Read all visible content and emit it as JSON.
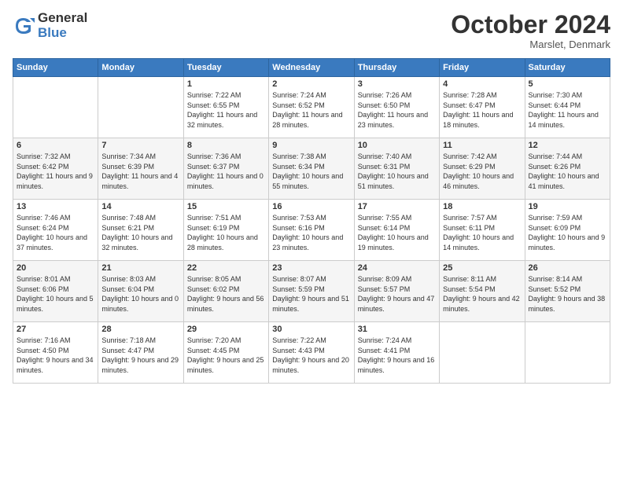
{
  "logo": {
    "general": "General",
    "blue": "Blue"
  },
  "header": {
    "month": "October 2024",
    "location": "Marslet, Denmark"
  },
  "weekdays": [
    "Sunday",
    "Monday",
    "Tuesday",
    "Wednesday",
    "Thursday",
    "Friday",
    "Saturday"
  ],
  "weeks": [
    [
      {
        "day": null
      },
      {
        "day": null
      },
      {
        "day": "1",
        "sunrise": "Sunrise: 7:22 AM",
        "sunset": "Sunset: 6:55 PM",
        "daylight": "Daylight: 11 hours and 32 minutes."
      },
      {
        "day": "2",
        "sunrise": "Sunrise: 7:24 AM",
        "sunset": "Sunset: 6:52 PM",
        "daylight": "Daylight: 11 hours and 28 minutes."
      },
      {
        "day": "3",
        "sunrise": "Sunrise: 7:26 AM",
        "sunset": "Sunset: 6:50 PM",
        "daylight": "Daylight: 11 hours and 23 minutes."
      },
      {
        "day": "4",
        "sunrise": "Sunrise: 7:28 AM",
        "sunset": "Sunset: 6:47 PM",
        "daylight": "Daylight: 11 hours and 18 minutes."
      },
      {
        "day": "5",
        "sunrise": "Sunrise: 7:30 AM",
        "sunset": "Sunset: 6:44 PM",
        "daylight": "Daylight: 11 hours and 14 minutes."
      }
    ],
    [
      {
        "day": "6",
        "sunrise": "Sunrise: 7:32 AM",
        "sunset": "Sunset: 6:42 PM",
        "daylight": "Daylight: 11 hours and 9 minutes."
      },
      {
        "day": "7",
        "sunrise": "Sunrise: 7:34 AM",
        "sunset": "Sunset: 6:39 PM",
        "daylight": "Daylight: 11 hours and 4 minutes."
      },
      {
        "day": "8",
        "sunrise": "Sunrise: 7:36 AM",
        "sunset": "Sunset: 6:37 PM",
        "daylight": "Daylight: 11 hours and 0 minutes."
      },
      {
        "day": "9",
        "sunrise": "Sunrise: 7:38 AM",
        "sunset": "Sunset: 6:34 PM",
        "daylight": "Daylight: 10 hours and 55 minutes."
      },
      {
        "day": "10",
        "sunrise": "Sunrise: 7:40 AM",
        "sunset": "Sunset: 6:31 PM",
        "daylight": "Daylight: 10 hours and 51 minutes."
      },
      {
        "day": "11",
        "sunrise": "Sunrise: 7:42 AM",
        "sunset": "Sunset: 6:29 PM",
        "daylight": "Daylight: 10 hours and 46 minutes."
      },
      {
        "day": "12",
        "sunrise": "Sunrise: 7:44 AM",
        "sunset": "Sunset: 6:26 PM",
        "daylight": "Daylight: 10 hours and 41 minutes."
      }
    ],
    [
      {
        "day": "13",
        "sunrise": "Sunrise: 7:46 AM",
        "sunset": "Sunset: 6:24 PM",
        "daylight": "Daylight: 10 hours and 37 minutes."
      },
      {
        "day": "14",
        "sunrise": "Sunrise: 7:48 AM",
        "sunset": "Sunset: 6:21 PM",
        "daylight": "Daylight: 10 hours and 32 minutes."
      },
      {
        "day": "15",
        "sunrise": "Sunrise: 7:51 AM",
        "sunset": "Sunset: 6:19 PM",
        "daylight": "Daylight: 10 hours and 28 minutes."
      },
      {
        "day": "16",
        "sunrise": "Sunrise: 7:53 AM",
        "sunset": "Sunset: 6:16 PM",
        "daylight": "Daylight: 10 hours and 23 minutes."
      },
      {
        "day": "17",
        "sunrise": "Sunrise: 7:55 AM",
        "sunset": "Sunset: 6:14 PM",
        "daylight": "Daylight: 10 hours and 19 minutes."
      },
      {
        "day": "18",
        "sunrise": "Sunrise: 7:57 AM",
        "sunset": "Sunset: 6:11 PM",
        "daylight": "Daylight: 10 hours and 14 minutes."
      },
      {
        "day": "19",
        "sunrise": "Sunrise: 7:59 AM",
        "sunset": "Sunset: 6:09 PM",
        "daylight": "Daylight: 10 hours and 9 minutes."
      }
    ],
    [
      {
        "day": "20",
        "sunrise": "Sunrise: 8:01 AM",
        "sunset": "Sunset: 6:06 PM",
        "daylight": "Daylight: 10 hours and 5 minutes."
      },
      {
        "day": "21",
        "sunrise": "Sunrise: 8:03 AM",
        "sunset": "Sunset: 6:04 PM",
        "daylight": "Daylight: 10 hours and 0 minutes."
      },
      {
        "day": "22",
        "sunrise": "Sunrise: 8:05 AM",
        "sunset": "Sunset: 6:02 PM",
        "daylight": "Daylight: 9 hours and 56 minutes."
      },
      {
        "day": "23",
        "sunrise": "Sunrise: 8:07 AM",
        "sunset": "Sunset: 5:59 PM",
        "daylight": "Daylight: 9 hours and 51 minutes."
      },
      {
        "day": "24",
        "sunrise": "Sunrise: 8:09 AM",
        "sunset": "Sunset: 5:57 PM",
        "daylight": "Daylight: 9 hours and 47 minutes."
      },
      {
        "day": "25",
        "sunrise": "Sunrise: 8:11 AM",
        "sunset": "Sunset: 5:54 PM",
        "daylight": "Daylight: 9 hours and 42 minutes."
      },
      {
        "day": "26",
        "sunrise": "Sunrise: 8:14 AM",
        "sunset": "Sunset: 5:52 PM",
        "daylight": "Daylight: 9 hours and 38 minutes."
      }
    ],
    [
      {
        "day": "27",
        "sunrise": "Sunrise: 7:16 AM",
        "sunset": "Sunset: 4:50 PM",
        "daylight": "Daylight: 9 hours and 34 minutes."
      },
      {
        "day": "28",
        "sunrise": "Sunrise: 7:18 AM",
        "sunset": "Sunset: 4:47 PM",
        "daylight": "Daylight: 9 hours and 29 minutes."
      },
      {
        "day": "29",
        "sunrise": "Sunrise: 7:20 AM",
        "sunset": "Sunset: 4:45 PM",
        "daylight": "Daylight: 9 hours and 25 minutes."
      },
      {
        "day": "30",
        "sunrise": "Sunrise: 7:22 AM",
        "sunset": "Sunset: 4:43 PM",
        "daylight": "Daylight: 9 hours and 20 minutes."
      },
      {
        "day": "31",
        "sunrise": "Sunrise: 7:24 AM",
        "sunset": "Sunset: 4:41 PM",
        "daylight": "Daylight: 9 hours and 16 minutes."
      },
      {
        "day": null
      },
      {
        "day": null
      }
    ]
  ]
}
